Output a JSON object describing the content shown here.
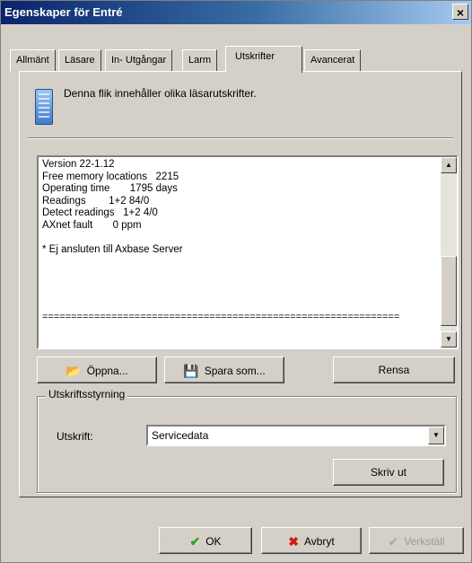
{
  "window": {
    "title": "Egenskaper för Entré",
    "close": "×"
  },
  "tabs": [
    {
      "label": "Allmänt"
    },
    {
      "label": "Läsare"
    },
    {
      "label": "In- Utgångar"
    },
    {
      "label": "Larm"
    },
    {
      "label": "Utskrifter",
      "active": true
    },
    {
      "label": "Avancerat"
    }
  ],
  "info": {
    "icon": "reader-device-icon",
    "text": "Denna flik innehåller olika läsarutskrifter."
  },
  "printout": {
    "lines": "Version 22-1.12\nFree memory locations   2215\nOperating time       1795 days\nReadings        1+2 84/0\nDetect readings   1+2 4/0\nAXnet fault       0 ppm\n\n* Ej ansluten till Axbase Server",
    "separator": "=============================================================="
  },
  "buttons": {
    "open": {
      "label": "Öppna...",
      "icon": "folder-open-icon"
    },
    "save_as": {
      "label": "Spara som...",
      "icon": "floppy-disk-icon"
    },
    "clear": {
      "label": "Rensa"
    },
    "print": {
      "label": "Skriv ut"
    },
    "ok": {
      "label": "OK",
      "icon": "checkmark-icon"
    },
    "cancel": {
      "label": "Avbryt",
      "icon": "x-mark-icon"
    },
    "apply": {
      "label": "Verkställ",
      "icon": "checkmark-icon"
    }
  },
  "print_control": {
    "legend": "Utskriftsstyrning",
    "field_label": "Utskrift:",
    "selected": "Servicedata"
  },
  "colors": {
    "ok_check": "#2fa01c",
    "cancel_x": "#d01c10",
    "title_bar": "#0a246a"
  }
}
